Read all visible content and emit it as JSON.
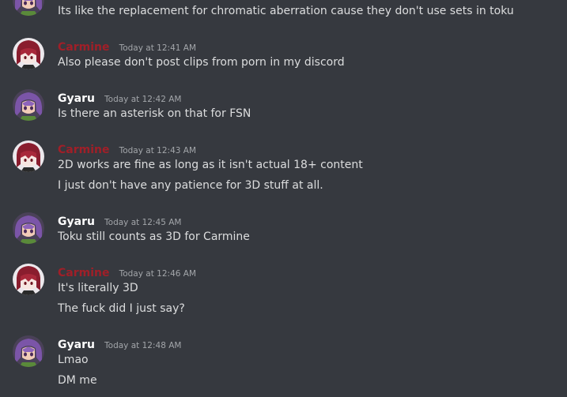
{
  "colors": {
    "background": "#36393f",
    "carmine_name": "#a01f28",
    "gyaru_name": "#ffffff",
    "message_text": "#dcddde",
    "timestamp": "#a3a6aa"
  },
  "messages": [
    {
      "lines": [
        "Its like the replacement for chromatic aberration cause they don't use sets in toku"
      ]
    },
    {
      "author": "Carmine",
      "avatar_icon": "carmine-avatar-icon",
      "timestamp": "Today at 12:41 AM",
      "lines": [
        "Also please don't post clips from porn in my discord"
      ]
    },
    {
      "author": "Gyaru",
      "avatar_icon": "gyaru-avatar-icon",
      "timestamp": "Today at 12:42 AM",
      "lines": [
        "Is there an asterisk on that for FSN"
      ]
    },
    {
      "author": "Carmine",
      "avatar_icon": "carmine-avatar-icon",
      "timestamp": "Today at 12:43 AM",
      "lines": [
        "2D works are fine as long as it isn't actual 18+ content",
        "I just don't have any patience for 3D stuff at all."
      ]
    },
    {
      "author": "Gyaru",
      "avatar_icon": "gyaru-avatar-icon",
      "timestamp": "Today at 12:45 AM",
      "lines": [
        "Toku still counts as 3D for Carmine"
      ]
    },
    {
      "author": "Carmine",
      "avatar_icon": "carmine-avatar-icon",
      "timestamp": "Today at 12:46 AM",
      "lines": [
        "It's literally 3D",
        "The fuck did I just say?"
      ]
    },
    {
      "author": "Gyaru",
      "avatar_icon": "gyaru-avatar-icon",
      "timestamp": "Today at 12:48 AM",
      "lines": [
        "Lmao",
        "DM me"
      ]
    }
  ]
}
